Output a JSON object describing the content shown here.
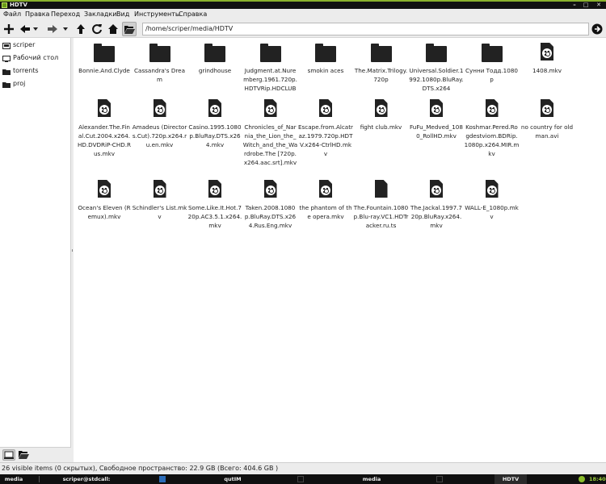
{
  "window": {
    "title": "HDTV"
  },
  "menu": [
    {
      "label": "Файл"
    },
    {
      "label": "Правка"
    },
    {
      "label": "Переход"
    },
    {
      "label": "Закладки"
    },
    {
      "label": "Вид"
    },
    {
      "label": "Инструменты"
    },
    {
      "label": "Справка"
    }
  ],
  "toolbar": {
    "path": "/home/scriper/media/HDTV",
    "icons": [
      "plus-icon",
      "back-arrow-icon",
      "forward-arrow-icon",
      "up-arrow-icon",
      "refresh-icon",
      "home-icon",
      "folder-open-icon",
      "go-icon"
    ]
  },
  "sidebar": {
    "items": [
      {
        "label": "scriper",
        "icon": "home-drive-icon"
      },
      {
        "label": "Рабочий стол",
        "icon": "desktop-icon"
      },
      {
        "label": "torrents",
        "icon": "folder-icon"
      },
      {
        "label": "proj",
        "icon": "folder-icon"
      }
    ]
  },
  "files": [
    {
      "name": "Bonnie.And.Clyde",
      "type": "folder"
    },
    {
      "name": "Cassandra's Dream",
      "type": "folder"
    },
    {
      "name": "grindhouse",
      "type": "folder"
    },
    {
      "name": "Judgment.at.Nuremberg.1961.720p.HDTVRip.HDCLUB",
      "type": "folder"
    },
    {
      "name": "smokin aces",
      "type": "folder"
    },
    {
      "name": "The.Matrix.Trilogy.720p",
      "type": "folder"
    },
    {
      "name": "Universal.Soldier.1992.1080p.BluRay.DTS.x264",
      "type": "folder"
    },
    {
      "name": "Сунни Тодд.1080p",
      "type": "folder"
    },
    {
      "name": "1408.mkv",
      "type": "video"
    },
    {
      "name": "Alexander.The.Final.Cut.2004.x264.HD.DVDRiP-CHD.Rus.mkv",
      "type": "video"
    },
    {
      "name": "Amadeus (Directors.Cut).720p.x264.ru.en.mkv",
      "type": "video"
    },
    {
      "name": "Casino.1995.1080p.BluRay.DTS.x264.mkv",
      "type": "video"
    },
    {
      "name": "Chronicles_of_Narnia_the_Lion_the_Witch_and_the_Wardrobe.The [720p.x264.aac.srt].mkv",
      "type": "video"
    },
    {
      "name": "Escape.from.Alcatraz.1979.720p.HDTV.x264-CtrlHD.mkv",
      "type": "video"
    },
    {
      "name": "fight club.mkv",
      "type": "video"
    },
    {
      "name": "FuFu_Medved_1080_RollHD.mkv",
      "type": "video"
    },
    {
      "name": "Koshmar.Pered.Rogdestviom.BDRip.1080p.x264.MIR.mkv",
      "type": "video"
    },
    {
      "name": "no country for old man.avi",
      "type": "video"
    },
    {
      "name": "Ocean's Eleven (Remux).mkv",
      "type": "video"
    },
    {
      "name": "Schindler's List.mkv",
      "type": "video"
    },
    {
      "name": "Some.Like.It.Hot.720p.AC3.5.1.x264.mkv",
      "type": "video"
    },
    {
      "name": "Taken.2008.1080p.BluRay.DTS.x264.Rus.Eng.mkv",
      "type": "video"
    },
    {
      "name": "the phantom of the opera.mkv",
      "type": "video"
    },
    {
      "name": "The.Fountain.1080p.Blu-ray.VC1.HDTracker.ru.ts",
      "type": "file"
    },
    {
      "name": "The.Jackal.1997.720p.BluRay.x264.mkv",
      "type": "video"
    },
    {
      "name": "WALL-E_1080p.mkv",
      "type": "video"
    }
  ],
  "status": {
    "text": "26 visible items (0 скрытых), Свободное пространство: 22.9 GB (Всего: 404.6 GB )"
  },
  "taskbar": {
    "items": [
      {
        "label": "media"
      },
      {
        "label": "scriper@stdcall: ~/media/HDTV"
      },
      {
        "label": "qutIM"
      },
      {
        "label": "media"
      },
      {
        "label": "HDTV"
      }
    ],
    "clock": "18:40"
  },
  "colors": {
    "accent": "#8ab22d",
    "taskbar": "#101010",
    "chrome": "#ececec"
  }
}
